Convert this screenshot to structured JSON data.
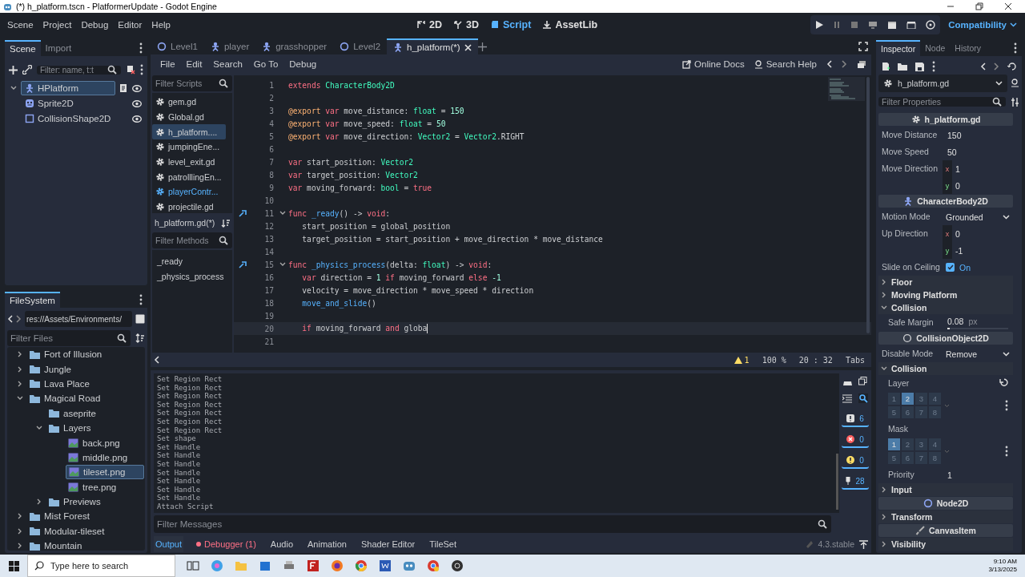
{
  "title_bar": {
    "title": "(*) h_platform.tscn - PlatformerUpdate - Godot Engine"
  },
  "top_bar": {
    "menus": [
      "Scene",
      "Project",
      "Debug",
      "Editor",
      "Help"
    ],
    "workspaces": [
      {
        "label": "2D",
        "selected": false
      },
      {
        "label": "3D",
        "selected": false
      },
      {
        "label": "Script",
        "selected": true
      },
      {
        "label": "AssetLib",
        "selected": false
      }
    ],
    "renderer": "Compatibility"
  },
  "scene_dock": {
    "tabs": [
      {
        "label": "Scene",
        "selected": true
      },
      {
        "label": "Import",
        "selected": false
      }
    ],
    "filter": {
      "placeholder": "Filter: name, t:t"
    },
    "tree": [
      {
        "name": "HPlatform",
        "kind": "character",
        "selected": true,
        "has_script": true,
        "children": [
          {
            "name": "Sprite2D",
            "kind": "sprite",
            "selected": false,
            "has_script": false
          },
          {
            "name": "CollisionShape2D",
            "kind": "shape",
            "selected": false,
            "has_script": false
          }
        ]
      }
    ]
  },
  "filesystem": {
    "tab": "FileSystem",
    "path": "res://Assets/Environments/",
    "filter": {
      "placeholder": "Filter Files"
    },
    "tree": [
      {
        "name": "Fort of Illusion",
        "kind": "folder",
        "expanded": false,
        "selected": false
      },
      {
        "name": "Jungle",
        "kind": "folder",
        "expanded": false,
        "selected": false
      },
      {
        "name": "Lava Place",
        "kind": "folder",
        "expanded": false,
        "selected": false
      },
      {
        "name": "Magical Road",
        "kind": "folder",
        "expanded": true,
        "selected": false,
        "children": [
          {
            "name": "aseprite",
            "kind": "folder",
            "expanded": false,
            "selected": false
          },
          {
            "name": "Layers",
            "kind": "folder",
            "expanded": true,
            "selected": false,
            "children": [
              {
                "name": "back.png",
                "kind": "image",
                "selected": false
              },
              {
                "name": "middle.png",
                "kind": "image",
                "selected": false
              },
              {
                "name": "tileset.png",
                "kind": "image",
                "selected": true
              },
              {
                "name": "tree.png",
                "kind": "image",
                "selected": false
              }
            ]
          },
          {
            "name": "Previews",
            "kind": "folder",
            "expanded": false,
            "selected": false
          }
        ]
      },
      {
        "name": "Mist Forest",
        "kind": "folder",
        "expanded": false,
        "selected": false
      },
      {
        "name": "Modular-tileset",
        "kind": "folder",
        "expanded": false,
        "selected": false
      },
      {
        "name": "Mountain",
        "kind": "folder",
        "expanded": false,
        "selected": false
      }
    ]
  },
  "scene_tabs": [
    {
      "label": "Level1",
      "kind": "node2d",
      "selected": false
    },
    {
      "label": "player",
      "kind": "character",
      "selected": false
    },
    {
      "label": "grasshopper",
      "kind": "character",
      "selected": false
    },
    {
      "label": "Level2",
      "kind": "node2d",
      "selected": false
    },
    {
      "label": "h_platform(*)",
      "kind": "character",
      "selected": true
    }
  ],
  "script_editor": {
    "menus": [
      "File",
      "Edit",
      "Search",
      "Go To",
      "Debug"
    ],
    "online_docs": "Online Docs",
    "search_help": "Search Help",
    "script_filter": {
      "placeholder": "Filter Scripts"
    },
    "scripts": [
      {
        "name": "gem.gd",
        "selected": false,
        "highlighted": false
      },
      {
        "name": "Global.gd",
        "selected": false,
        "highlighted": false
      },
      {
        "name": "h_platform....",
        "selected": true,
        "highlighted": false
      },
      {
        "name": "jumpingEne...",
        "selected": false,
        "highlighted": false
      },
      {
        "name": "level_exit.gd",
        "selected": false,
        "highlighted": false
      },
      {
        "name": "patrolllingEn...",
        "selected": false,
        "highlighted": false
      },
      {
        "name": "playerContr...",
        "selected": false,
        "highlighted": true
      },
      {
        "name": "projectile.gd",
        "selected": false,
        "highlighted": false
      }
    ],
    "current_script": "h_platform.gd(*)",
    "method_filter": {
      "placeholder": "Filter Methods"
    },
    "methods": [
      "_ready",
      "_physics_process"
    ],
    "lines": [
      {
        "n": "1",
        "marker": false,
        "current": false,
        "text": "extends CharacterBody2D"
      },
      {
        "n": "2",
        "marker": false,
        "current": false
      },
      {
        "n": "3",
        "marker": false,
        "current": false,
        "text": "@export var move_distance: float = 150"
      },
      {
        "n": "4",
        "marker": false,
        "current": false,
        "text": "@export var move_speed: float = 50"
      },
      {
        "n": "5",
        "marker": false,
        "current": false,
        "text": "@export var move_direction: Vector2 = Vector2.RIGHT"
      },
      {
        "n": "6",
        "marker": false,
        "current": false
      },
      {
        "n": "7",
        "marker": false,
        "current": false,
        "text": "var start_position: Vector2"
      },
      {
        "n": "8",
        "marker": false,
        "current": false,
        "text": "var target_position: Vector2"
      },
      {
        "n": "9",
        "marker": false,
        "current": false,
        "text": "var moving_forward: bool = true"
      },
      {
        "n": "10",
        "marker": false,
        "current": false
      },
      {
        "n": "11",
        "marker": true,
        "current": false,
        "text": "func _ready() -> void:"
      },
      {
        "n": "12",
        "marker": false,
        "current": false,
        "text": "\tstart_position = global_position"
      },
      {
        "n": "13",
        "marker": false,
        "current": false,
        "text": "\ttarget_position = start_position + move_direction * move_distance"
      },
      {
        "n": "14",
        "marker": false,
        "current": false
      },
      {
        "n": "15",
        "marker": true,
        "current": false,
        "text": "func _physics_process(delta: float) -> void:"
      },
      {
        "n": "16",
        "marker": false,
        "current": false,
        "text": "\tvar direction = 1 if moving_forward else -1"
      },
      {
        "n": "17",
        "marker": false,
        "current": false,
        "text": "\tvelocity = move_direction * move_speed * direction"
      },
      {
        "n": "18",
        "marker": false,
        "current": false,
        "text": "\tmove_and_slide()"
      },
      {
        "n": "19",
        "marker": false,
        "current": false
      },
      {
        "n": "20",
        "marker": false,
        "current": true,
        "text": "\tif moving_forward and globa"
      },
      {
        "n": "21",
        "marker": false,
        "current": false
      }
    ],
    "status": {
      "warnings": "1",
      "zoom": "100 %",
      "position": "20 :  32",
      "indent": "Tabs"
    }
  },
  "output": {
    "lines": [
      "Set Region Rect",
      "Set Region Rect",
      "Set Region Rect",
      "Set Region Rect",
      "Set Region Rect",
      "Set Region Rect",
      "Set Region Rect",
      "Set shape",
      "Set Handle",
      "Set Handle",
      "Set Handle",
      "Set Handle",
      "Set Handle",
      "Set Handle",
      "Set Handle",
      "Attach Script"
    ],
    "filter": {
      "placeholder": "Filter Messages"
    },
    "counters": [
      {
        "kind": "message",
        "count": "6"
      },
      {
        "kind": "error",
        "count": "0"
      },
      {
        "kind": "warning",
        "count": "0"
      },
      {
        "kind": "editor",
        "count": "28"
      }
    ],
    "tabs": [
      {
        "label": "Output",
        "selected": true,
        "alert": false
      },
      {
        "label": "Debugger (1)",
        "selected": false,
        "alert": true
      },
      {
        "label": "Audio",
        "selected": false,
        "alert": false
      },
      {
        "label": "Animation",
        "selected": false,
        "alert": false
      },
      {
        "label": "Shader Editor",
        "selected": false,
        "alert": false
      },
      {
        "label": "TileSet",
        "selected": false,
        "alert": false
      }
    ],
    "version": "4.3.stable"
  },
  "inspector": {
    "tabs": [
      {
        "label": "Inspector",
        "selected": true
      },
      {
        "label": "Node",
        "selected": false
      },
      {
        "label": "History",
        "selected": false
      }
    ],
    "resource": "h_platform.gd",
    "filter": {
      "placeholder": "Filter Properties"
    },
    "sections": [
      {
        "label": "h_platform.gd",
        "kind": "script",
        "rows": [
          {
            "kind": "value",
            "label": "Move Distance",
            "value": "150"
          },
          {
            "kind": "value",
            "label": "Move Speed",
            "value": "50"
          },
          {
            "kind": "vector",
            "label": "Move Direction",
            "components": [
              {
                "axis": "x",
                "value": "1"
              },
              {
                "axis": "y",
                "value": "0"
              }
            ]
          }
        ]
      },
      {
        "label": "CharacterBody2D",
        "kind": "character",
        "rows": [
          {
            "kind": "enum",
            "label": "Motion Mode",
            "value": "Grounded"
          },
          {
            "kind": "vector",
            "label": "Up Direction",
            "components": [
              {
                "axis": "x",
                "value": "0"
              },
              {
                "axis": "y",
                "value": "-1"
              }
            ]
          },
          {
            "kind": "bool",
            "label": "Slide on Ceiling",
            "checked": true,
            "value": "On"
          },
          {
            "kind": "group",
            "label": "Floor",
            "expanded": false
          },
          {
            "kind": "group",
            "label": "Moving Platform",
            "expanded": false
          },
          {
            "kind": "group",
            "label": "Collision",
            "expanded": true,
            "children": [
              {
                "kind": "slider",
                "label": "Safe Margin",
                "value": "0.08",
                "unit": "px",
                "level": 0.02
              }
            ]
          }
        ]
      },
      {
        "label": "CollisionObject2D",
        "kind": "object",
        "rows": [
          {
            "kind": "enum",
            "label": "Disable Mode",
            "value": "Remove"
          },
          {
            "kind": "group",
            "label": "Collision",
            "expanded": true,
            "children": [
              {
                "kind": "layers",
                "label": "Layer",
                "revertable": true,
                "cells": [
                  {
                    "label": "1",
                    "selected": false
                  },
                  {
                    "label": "2",
                    "selected": true
                  },
                  {
                    "label": "3",
                    "selected": false
                  },
                  {
                    "label": "4",
                    "selected": false
                  },
                  {
                    "label": "5",
                    "selected": false
                  },
                  {
                    "label": "6",
                    "selected": false
                  },
                  {
                    "label": "7",
                    "selected": false
                  },
                  {
                    "label": "8",
                    "selected": false
                  }
                ]
              },
              {
                "kind": "layers",
                "label": "Mask",
                "revertable": false,
                "cells": [
                  {
                    "label": "1",
                    "selected": true
                  },
                  {
                    "label": "2",
                    "selected": false
                  },
                  {
                    "label": "3",
                    "selected": false
                  },
                  {
                    "label": "4",
                    "selected": false
                  },
                  {
                    "label": "5",
                    "selected": false
                  },
                  {
                    "label": "6",
                    "selected": false
                  },
                  {
                    "label": "7",
                    "selected": false
                  },
                  {
                    "label": "8",
                    "selected": false
                  }
                ]
              },
              {
                "kind": "value",
                "label": "Priority",
                "value": "1"
              }
            ]
          },
          {
            "kind": "group",
            "label": "Input",
            "expanded": false
          }
        ]
      },
      {
        "label": "Node2D",
        "kind": "node2d",
        "rows": [
          {
            "kind": "group",
            "label": "Transform",
            "expanded": false
          }
        ]
      },
      {
        "label": "CanvasItem",
        "kind": "canvas",
        "rows": [
          {
            "kind": "group",
            "label": "Visibility",
            "expanded": false
          }
        ]
      }
    ]
  },
  "taskbar": {
    "search": {
      "placeholder": "Type here to search"
    },
    "time": "9:10 AM",
    "date": "3/13/2025"
  }
}
